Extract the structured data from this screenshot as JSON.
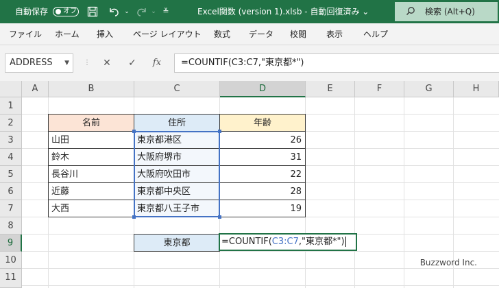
{
  "titlebar": {
    "autosave_label": "自動保存",
    "autosave_state": "オフ",
    "save_icon": "save-icon",
    "undo_icon": "undo-icon",
    "redo_icon": "redo-icon",
    "customize_icon": "customize-qat-icon",
    "file_title": "Excel関数 (version 1).xlsb  -  自動回復済み  ⌄",
    "search_placeholder": "検索 (Alt+Q)",
    "background": "#217346"
  },
  "ribbon": {
    "tabs": [
      "ファイル",
      "ホーム",
      "挿入",
      "ページ レイアウト",
      "数式",
      "データ",
      "校閲",
      "表示",
      "ヘルプ"
    ]
  },
  "formula_bar": {
    "name_box": "ADDRESS",
    "cancel_symbol": "✕",
    "enter_symbol": "✓",
    "fx_symbol": "fx",
    "formula": "=COUNTIF(C3:C7,\"東京都*\")"
  },
  "sheet": {
    "columns": [
      "A",
      "B",
      "C",
      "D",
      "E",
      "F",
      "G",
      "H"
    ],
    "selected_column": "D",
    "rows": [
      "1",
      "2",
      "3",
      "4",
      "5",
      "6",
      "7",
      "8",
      "9",
      "10",
      "11"
    ],
    "selected_row": "9",
    "table_headers": [
      "名前",
      "住所",
      "年齢"
    ],
    "table_rows": [
      {
        "name": "山田",
        "address": "東京都港区",
        "age": "26"
      },
      {
        "name": "鈴木",
        "address": "大阪府堺市",
        "age": "31"
      },
      {
        "name": "長谷川",
        "address": "大阪府吹田市",
        "age": "22"
      },
      {
        "name": "近藤",
        "address": "東京都中央区",
        "age": "28"
      },
      {
        "name": "大西",
        "address": "東京都八王子市",
        "age": "19"
      }
    ],
    "criteria_label": "東京都",
    "editing_cell": {
      "prefix": "=COUNTIF(",
      "range_ref": "C3:C7",
      "suffix": ",\"東京都*\")"
    },
    "header_colors": {
      "name": "#fce4d6",
      "address": "#ddebf7",
      "age": "#fff2cc"
    }
  },
  "watermark": "Buzzword Inc."
}
